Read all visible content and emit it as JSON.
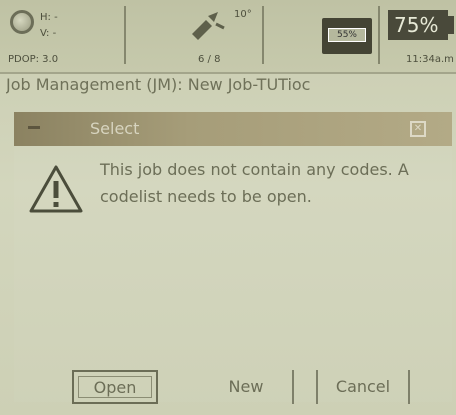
{
  "status_bar": {
    "position_line1": "H: -",
    "position_line2": "V: -",
    "pdop": "PDOP: 3.0",
    "rtk_angle": "10°",
    "satellites": "6 / 8",
    "memory_label": "55%",
    "battery": "75%",
    "time": "11:34a.m"
  },
  "app": {
    "title": "Job Management (JM): New Job-TUTioc"
  },
  "dialog": {
    "title": "Select",
    "message": "This job does not contain any codes. A codelist needs to be open.",
    "buttons": {
      "open": "Open",
      "new": "New",
      "cancel": "Cancel"
    }
  }
}
